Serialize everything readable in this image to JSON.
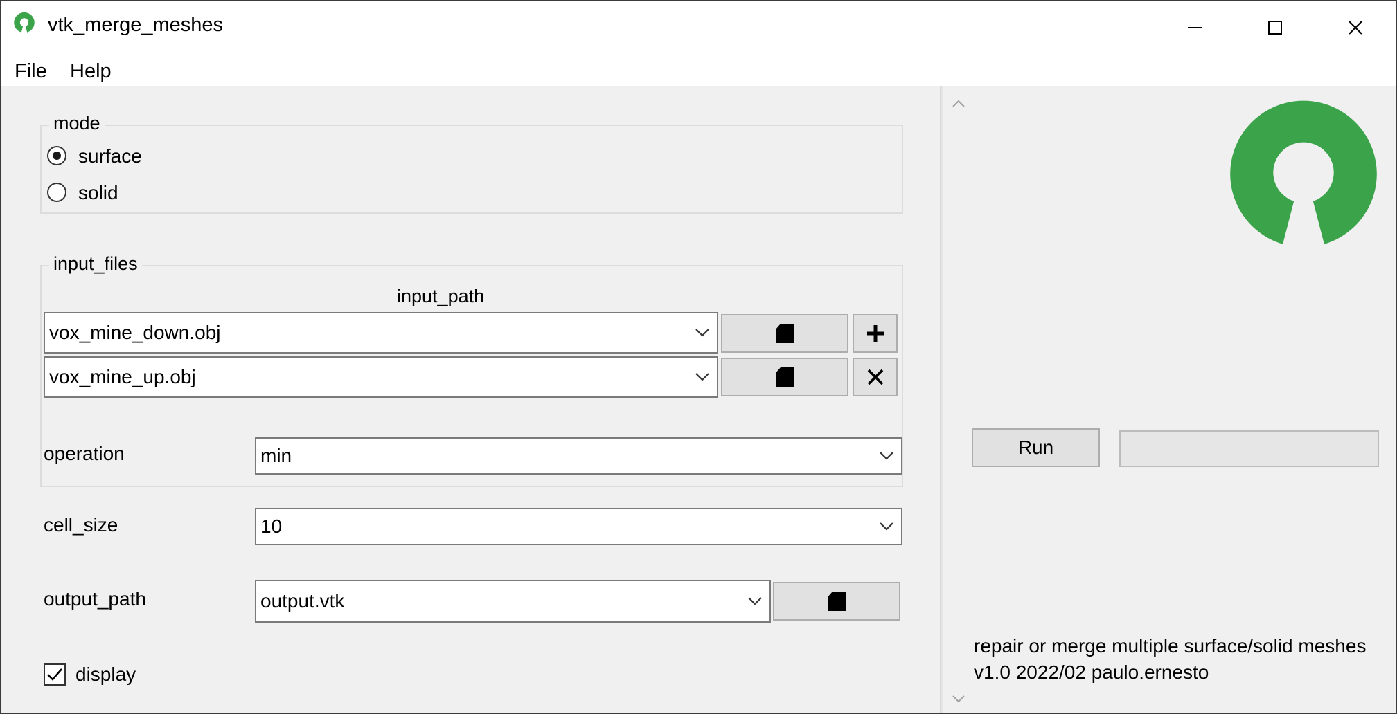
{
  "window": {
    "title": "vtk_merge_meshes",
    "icon": "open-source-logo-icon"
  },
  "menu": {
    "file": "File",
    "help": "Help"
  },
  "mode": {
    "title": "mode",
    "options": [
      {
        "label": "surface",
        "selected": true
      },
      {
        "label": "solid",
        "selected": false
      }
    ]
  },
  "input_files": {
    "title": "input_files",
    "column_header": "input_path",
    "rows": [
      {
        "path": "vox_mine_down.obj",
        "action_icon": "plus-icon"
      },
      {
        "path": "vox_mine_up.obj",
        "action_icon": "close-icon"
      }
    ]
  },
  "operation": {
    "label": "operation",
    "value": "min"
  },
  "cell_size": {
    "label": "cell_size",
    "value": "10"
  },
  "output_path": {
    "label": "output_path",
    "value": "output.vtk"
  },
  "display": {
    "label": "display",
    "checked": true
  },
  "run": {
    "label": "Run",
    "progress": 0
  },
  "info": {
    "line1": "repair or merge multiple surface/solid meshes",
    "line2": "v1.0 2022/02 paulo.ernesto"
  },
  "colors": {
    "logo_green": "#3ba44b",
    "background": "#f0f0f0"
  }
}
